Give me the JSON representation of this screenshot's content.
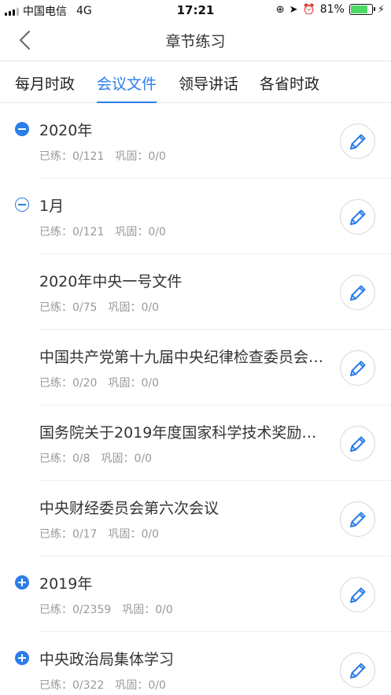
{
  "status_bar": {
    "carrier": "中国电信",
    "network": "4G",
    "time": "17:21",
    "battery": "81%",
    "battery_level": 0.81,
    "battery_color": "#4cd964"
  },
  "nav": {
    "title": "章节练习",
    "back_icon": "chevron-left-icon"
  },
  "tabs": [
    {
      "label": "每月时政",
      "active": false
    },
    {
      "label": "会议文件",
      "active": true
    },
    {
      "label": "领导讲话",
      "active": false
    },
    {
      "label": "各省时政",
      "active": false
    }
  ],
  "accent_color": "#2b7de9",
  "list_items": [
    {
      "title": "2020年",
      "done_label": "已练：",
      "done": "0/121",
      "review_label": "巩固：",
      "review": "0/0",
      "icon": "minus-circle-filled-icon"
    },
    {
      "title": "1月",
      "done_label": "已练：",
      "done": "0/121",
      "review_label": "巩固：",
      "review": "0/0",
      "icon": "minus-circle-outline-icon"
    },
    {
      "title": "2020年中央一号文件",
      "done_label": "已练：",
      "done": "0/75",
      "review_label": "巩固：",
      "review": "0/0",
      "icon": "none"
    },
    {
      "title": "中国共产党第十九届中央纪律检查委员会…",
      "done_label": "已练：",
      "done": "0/20",
      "review_label": "巩固：",
      "review": "0/0",
      "icon": "none"
    },
    {
      "title": "国务院关于2019年度国家科学技术奖励…",
      "done_label": "已练：",
      "done": "0/8",
      "review_label": "巩固：",
      "review": "0/0",
      "icon": "none"
    },
    {
      "title": "中央财经委员会第六次会议",
      "done_label": "已练：",
      "done": "0/17",
      "review_label": "巩固：",
      "review": "0/0",
      "icon": "none"
    },
    {
      "title": "2019年",
      "done_label": "已练：",
      "done": "0/2359",
      "review_label": "巩固：",
      "review": "0/0",
      "icon": "plus-circle-filled-icon"
    },
    {
      "title": "中央政治局集体学习",
      "done_label": "已练：",
      "done": "0/322",
      "review_label": "巩固：",
      "review": "0/0",
      "icon": "plus-circle-filled-icon"
    }
  ]
}
